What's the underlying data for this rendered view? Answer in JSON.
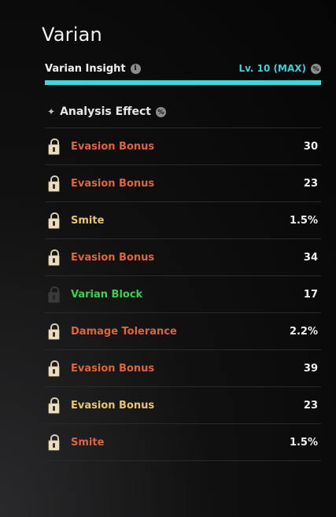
{
  "title": "Varian",
  "insight": {
    "label": "Varian Insight",
    "level": "Lv. 10 (MAX)",
    "progress_fraction": 1.0
  },
  "section": {
    "label": "Analysis Effect"
  },
  "colors": {
    "orange": "#e0643a",
    "gold": "#e8c46a",
    "green": "#3ccf4e",
    "cyan": "#3fd6de"
  },
  "effects": [
    {
      "name": "Evasion Bonus",
      "value": "30",
      "color": "#e0643a",
      "locked": true
    },
    {
      "name": "Evasion Bonus",
      "value": "23",
      "color": "#e0643a",
      "locked": true
    },
    {
      "name": "Smite",
      "value": "1.5%",
      "color": "#e8c46a",
      "locked": true
    },
    {
      "name": "Evasion Bonus",
      "value": "34",
      "color": "#e0643a",
      "locked": true
    },
    {
      "name": "Varian Block",
      "value": "17",
      "color": "#3ccf4e",
      "locked": false
    },
    {
      "name": "Damage Tolerance",
      "value": "2.2%",
      "color": "#e0643a",
      "locked": true
    },
    {
      "name": "Evasion Bonus",
      "value": "39",
      "color": "#e0643a",
      "locked": true
    },
    {
      "name": "Evasion Bonus",
      "value": "23",
      "color": "#e8c46a",
      "locked": true
    },
    {
      "name": "Smite",
      "value": "1.5%",
      "color": "#e0643a",
      "locked": true
    }
  ]
}
